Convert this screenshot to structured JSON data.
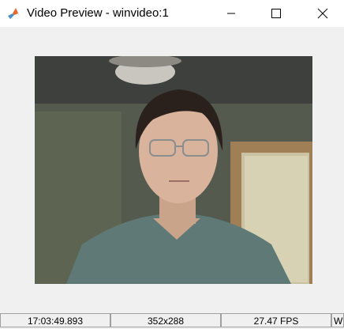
{
  "window": {
    "title": "Video Preview - winvideo:1",
    "app_icon": "matlab-icon"
  },
  "controls": {
    "minimize_icon": "minimize-icon",
    "maximize_icon": "maximize-icon",
    "close_icon": "close-icon"
  },
  "preview": {
    "content": "webcam-frame"
  },
  "status": {
    "timestamp": "17:03:49.893",
    "resolution": "352x288",
    "frame_rate": "27.47 FPS",
    "extra": "W"
  }
}
